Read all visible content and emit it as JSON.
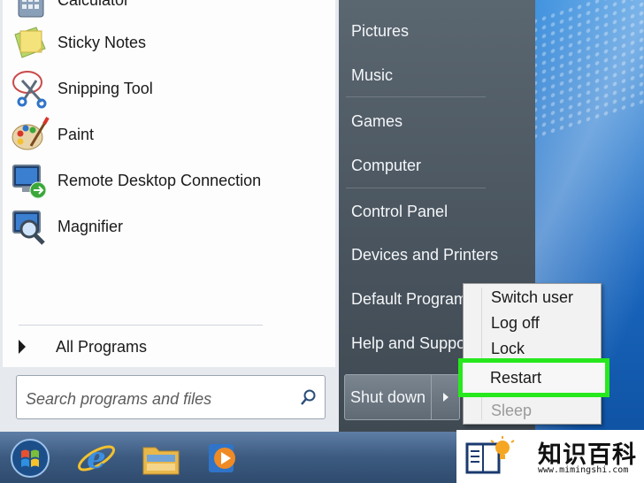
{
  "start_menu": {
    "programs": [
      {
        "label": "Calculator",
        "icon": "calculator-icon"
      },
      {
        "label": "Sticky Notes",
        "icon": "sticky-notes-icon"
      },
      {
        "label": "Snipping Tool",
        "icon": "snipping-tool-icon"
      },
      {
        "label": "Paint",
        "icon": "paint-icon"
      },
      {
        "label": "Remote Desktop Connection",
        "icon": "remote-desktop-icon"
      },
      {
        "label": "Magnifier",
        "icon": "magnifier-icon"
      }
    ],
    "all_programs_label": "All Programs",
    "search": {
      "placeholder": "Search programs and files"
    },
    "places": [
      {
        "label": "Pictures"
      },
      {
        "label": "Music"
      },
      {
        "label": "Games"
      },
      {
        "label": "Computer"
      },
      {
        "label": "Control Panel"
      },
      {
        "label": "Devices and Printers"
      },
      {
        "label": "Default Programs"
      },
      {
        "label": "Help and Support"
      }
    ],
    "shutdown_label": "Shut down"
  },
  "power_menu": {
    "items": [
      {
        "label": "Switch user",
        "enabled": true
      },
      {
        "label": "Log off",
        "enabled": true
      },
      {
        "label": "Lock",
        "enabled": true
      },
      {
        "label": "Restart",
        "enabled": true,
        "highlighted": true
      },
      {
        "label": "Sleep",
        "enabled": false
      }
    ],
    "highlight_color": "#27e81d"
  },
  "taskbar": {
    "items": [
      {
        "icon": "windows-start-icon"
      },
      {
        "icon": "internet-explorer-icon"
      },
      {
        "icon": "folder-icon"
      },
      {
        "icon": "media-player-icon"
      }
    ]
  },
  "watermark": {
    "title": "知识百科",
    "url": "www.mimingshi.com"
  }
}
